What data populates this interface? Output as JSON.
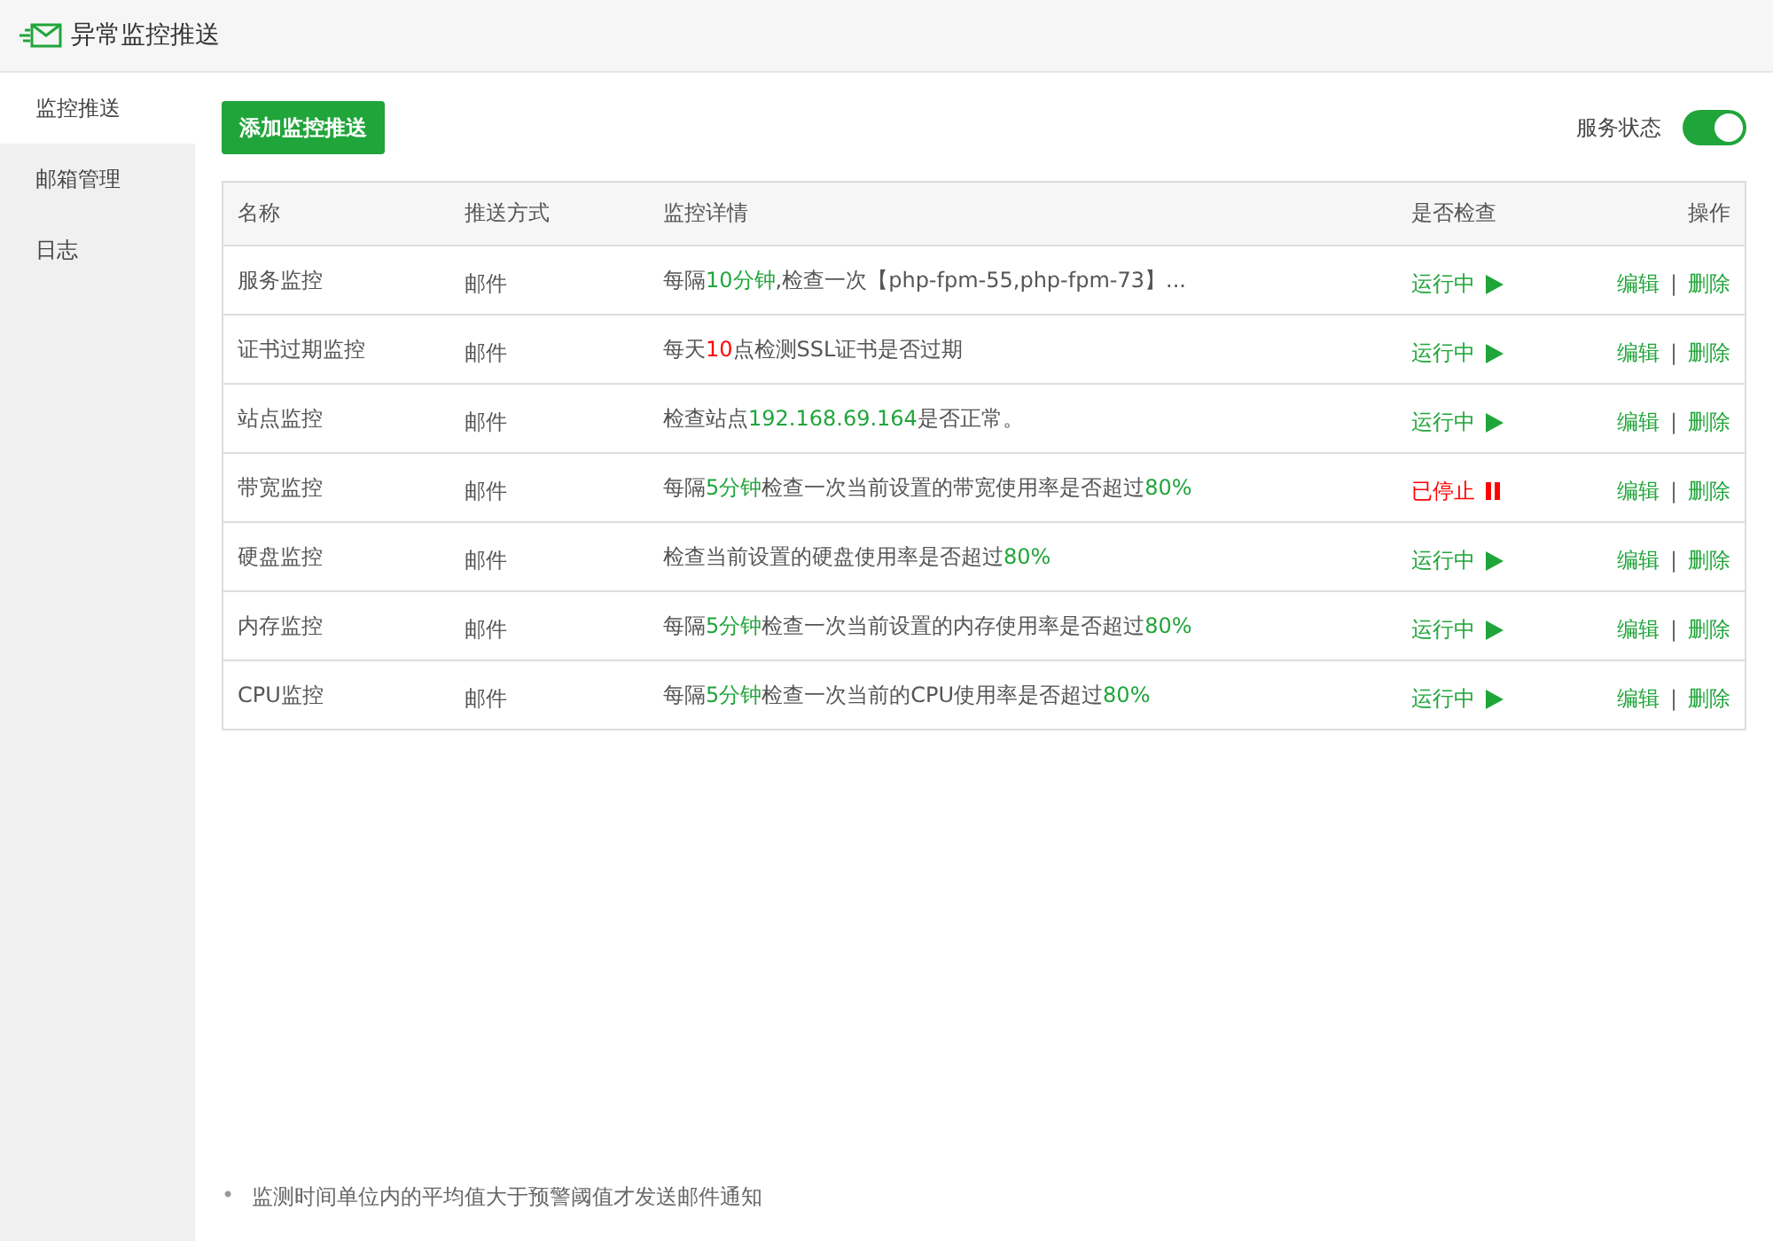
{
  "window": {
    "title": "异常监控推送"
  },
  "sidebar": {
    "items": [
      {
        "label": "监控推送",
        "selected": true
      },
      {
        "label": "邮箱管理",
        "selected": false
      },
      {
        "label": "日志",
        "selected": false
      }
    ]
  },
  "add_button": "添加监控推送",
  "service_status": {
    "label": "服务状态",
    "on": true
  },
  "table": {
    "columns": [
      "名称",
      "推送方式",
      "监控详情",
      "是否检查",
      "操作"
    ],
    "rows": [
      {
        "name": "服务监控",
        "method": "邮件",
        "detail": [
          {
            "text": "每隔"
          },
          {
            "text": "10分钟",
            "color": "#20a53a"
          },
          {
            "text": ",检查一次【php-fpm-55,php-fpm-73】..."
          }
        ],
        "status": "运行中",
        "running": true,
        "actions": [
          "编辑",
          "|",
          "删除"
        ]
      },
      {
        "name": "证书过期监控",
        "method": "邮件",
        "detail": [
          {
            "text": "每天"
          },
          {
            "text": "10",
            "color": "#ff0000"
          },
          {
            "text": "点检测SSL证书是否过期"
          }
        ],
        "status": "运行中",
        "running": true,
        "actions": [
          "编辑",
          "|",
          "删除"
        ]
      },
      {
        "name": "站点监控",
        "method": "邮件",
        "detail": [
          {
            "text": "检查站点"
          },
          {
            "text": "192.168.69.164",
            "color": "#20a53a"
          },
          {
            "text": "是否正常。"
          }
        ],
        "status": "运行中",
        "running": true,
        "actions": [
          "编辑",
          "|",
          "删除"
        ]
      },
      {
        "name": "带宽监控",
        "method": "邮件",
        "detail": [
          {
            "text": "每隔"
          },
          {
            "text": "5分钟",
            "color": "#20a53a"
          },
          {
            "text": "检查一次当前设置的带宽使用率是否超过"
          },
          {
            "text": "80%",
            "color": "#20a53a"
          }
        ],
        "status": "已停止",
        "running": false,
        "actions": [
          "编辑",
          "|",
          "删除"
        ]
      },
      {
        "name": "硬盘监控",
        "method": "邮件",
        "detail": [
          {
            "text": "检查当前设置的硬盘使用率是否超过"
          },
          {
            "text": "80%",
            "color": "#20a53a"
          }
        ],
        "status": "运行中",
        "running": true,
        "actions": [
          "编辑",
          "|",
          "删除"
        ]
      },
      {
        "name": "内存监控",
        "method": "邮件",
        "detail": [
          {
            "text": "每隔"
          },
          {
            "text": "5分钟",
            "color": "#20a53a"
          },
          {
            "text": "检查一次当前设置的内存使用率是否超过"
          },
          {
            "text": "80%",
            "color": "#20a53a"
          }
        ],
        "status": "运行中",
        "running": true,
        "actions": [
          "编辑",
          "|",
          "删除"
        ]
      },
      {
        "name": "CPU监控",
        "method": "邮件",
        "detail": [
          {
            "text": "每隔"
          },
          {
            "text": "5分钟",
            "color": "#20a53a"
          },
          {
            "text": "检查一次当前的CPU使用率是否超过"
          },
          {
            "text": "80%",
            "color": "#20a53a"
          }
        ],
        "status": "运行中",
        "running": true,
        "actions": [
          "编辑",
          "|",
          "删除"
        ]
      }
    ]
  },
  "notes": [
    {
      "bullet": "•",
      "text": "监测时间单位内的平均值大于预警阈值才发送邮件通知"
    }
  ]
}
